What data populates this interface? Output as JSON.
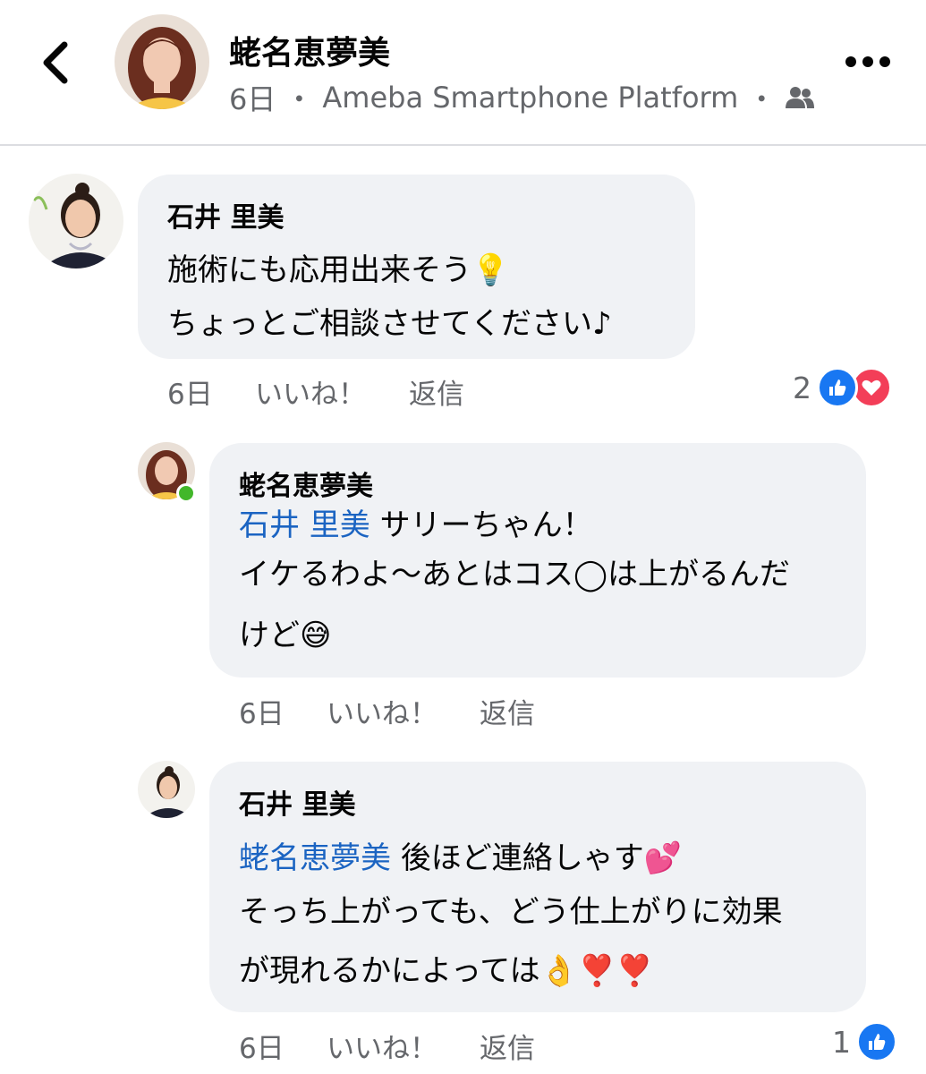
{
  "header": {
    "author": "蛯名恵夢美",
    "age": "6日",
    "separator": "・",
    "platform": "Ameba Smartphone Platform",
    "separator2": "・",
    "audience_icon": "friends-icon",
    "back_icon": "chevron-left-icon",
    "more_icon": "more-horizontal-icon"
  },
  "comments": [
    {
      "author": "石井 里美",
      "line1": "施術にも応用出来そう",
      "line1_emoji": "💡",
      "line2": "ちょっとご相談させてください♪",
      "age": "6日",
      "like_label": "いいね！",
      "reply_label": "返信",
      "reaction_count": "2",
      "reactions": [
        "like",
        "love"
      ]
    },
    {
      "author": "蛯名恵夢美",
      "mention": "石井 里美",
      "line1": " サリーちゃん！",
      "line2": "イケるわよ〜あとはコス◯は上がるんだ",
      "line3": "けど",
      "line3_emoji": "😅",
      "age": "6日",
      "like_label": "いいね！",
      "reply_label": "返信",
      "online": true
    },
    {
      "author": "石井 里美",
      "mention": "蛯名恵夢美",
      "line1": " 後ほど連絡しゃす",
      "line1_emoji": "💕",
      "line2": "そっち上がっても、どう仕上がりに効果",
      "line3": "が現れるかによっては",
      "line3_emoji": "👌❣️❣️",
      "age": "6日",
      "like_label": "いいね！",
      "reply_label": "返信",
      "reaction_count": "1",
      "reactions": [
        "like"
      ]
    }
  ],
  "colors": {
    "bubble": "#f0f2f5",
    "mention": "#1b64c2",
    "meta": "#65676b",
    "like": "#1877f2",
    "love": "#f33e58",
    "online": "#42b72a"
  }
}
